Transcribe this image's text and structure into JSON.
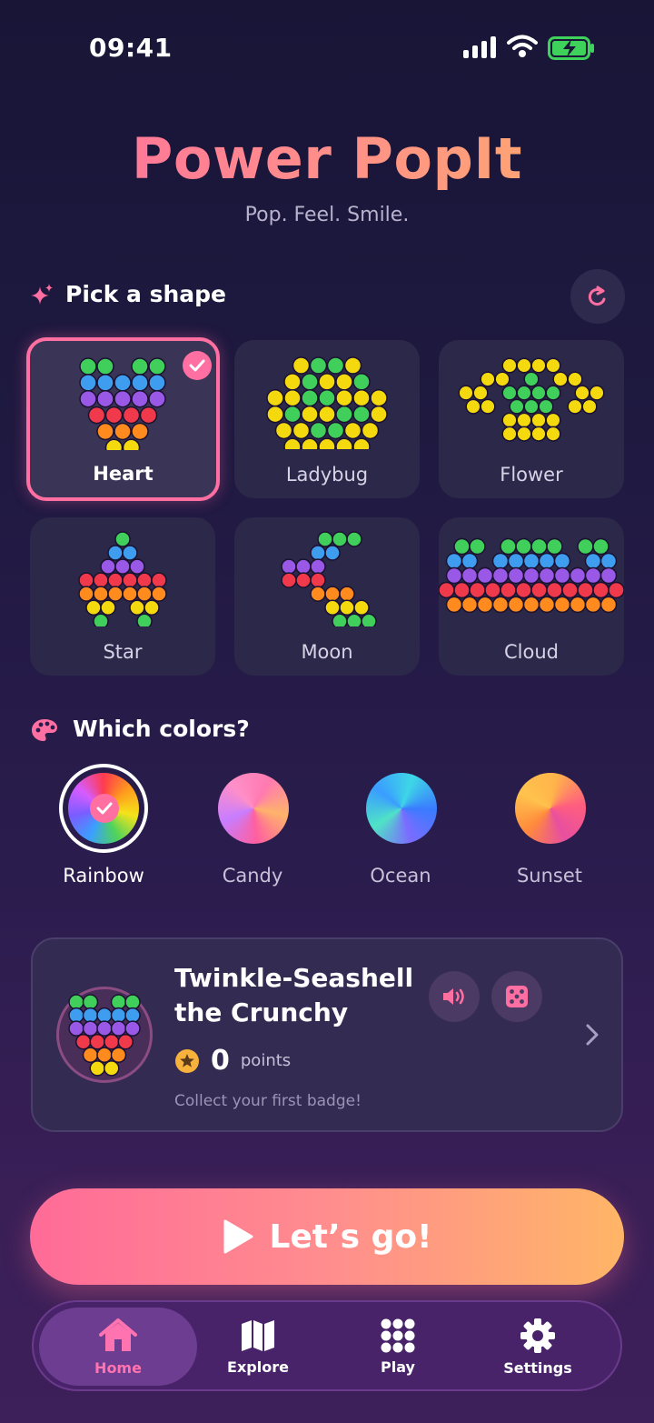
{
  "status": {
    "time": "09:41"
  },
  "header": {
    "title": "Power PopIt",
    "subtitle": "Pop. Feel. Smile."
  },
  "shapes_section": {
    "title": "Pick a shape",
    "icon": "sparkles-icon",
    "refresh_icon": "refresh-icon"
  },
  "shapes": [
    {
      "label": "Heart",
      "selected": true
    },
    {
      "label": "Ladybug",
      "selected": false
    },
    {
      "label": "Flower",
      "selected": false
    },
    {
      "label": "Star",
      "selected": false
    },
    {
      "label": "Moon",
      "selected": false
    },
    {
      "label": "Cloud",
      "selected": false
    }
  ],
  "colors_section": {
    "title": "Which colors?",
    "icon": "palette-icon"
  },
  "palettes": [
    {
      "label": "Rainbow",
      "selected": true
    },
    {
      "label": "Candy",
      "selected": false
    },
    {
      "label": "Ocean",
      "selected": false
    },
    {
      "label": "Sunset",
      "selected": false
    }
  ],
  "profile": {
    "name_line1": "Twinkle-Seashell",
    "name_line2": "the Crunchy",
    "points": "0",
    "points_label": "points",
    "hint": "Collect your first badge!"
  },
  "cta": {
    "label": "Let’s go!"
  },
  "tabs": [
    {
      "label": "Home",
      "icon": "home-icon",
      "active": true
    },
    {
      "label": "Explore",
      "icon": "map-icon",
      "active": false
    },
    {
      "label": "Play",
      "icon": "grid-dots-icon",
      "active": false
    },
    {
      "label": "Settings",
      "icon": "gear-icon",
      "active": false
    }
  ],
  "colors": {
    "accent_pink": "#ff6fa1",
    "accent_orange": "#ffb067",
    "bubble_green": "#3fcf5a",
    "bubble_blue": "#3f9df0",
    "bubble_purple": "#9a58e6",
    "bubble_red": "#f0394a",
    "bubble_orange": "#ff8a1e",
    "bubble_yellow": "#f5d90f"
  }
}
